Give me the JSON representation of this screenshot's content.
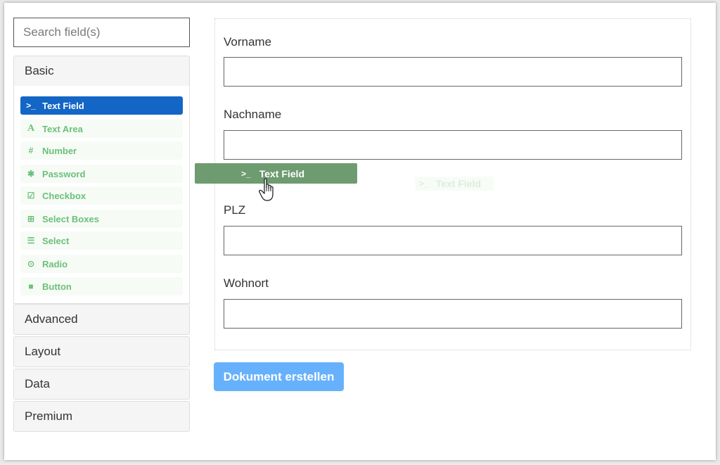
{
  "search": {
    "placeholder": "Search field(s)"
  },
  "groups": {
    "basic": "Basic",
    "advanced": "Advanced",
    "layout": "Layout",
    "data": "Data",
    "premium": "Premium"
  },
  "components": [
    {
      "icon": "terminal-icon",
      "glyph": ">_",
      "label": "Text Field"
    },
    {
      "icon": "font-icon",
      "glyph": "A",
      "label": "Text Area"
    },
    {
      "icon": "hash-icon",
      "glyph": "#",
      "label": "Number"
    },
    {
      "icon": "asterisk-icon",
      "glyph": "✱",
      "label": "Password"
    },
    {
      "icon": "check-square-icon",
      "glyph": "☑",
      "label": "Checkbox"
    },
    {
      "icon": "plus-square-icon",
      "glyph": "⊞",
      "label": "Select Boxes"
    },
    {
      "icon": "list-icon",
      "glyph": "☰",
      "label": "Select"
    },
    {
      "icon": "dot-circle-icon",
      "glyph": "⊙",
      "label": "Radio"
    },
    {
      "icon": "stop-icon",
      "glyph": "■",
      "label": "Button"
    }
  ],
  "form": {
    "fields": [
      "Vorname",
      "Nachname",
      "PLZ",
      "Wohnort"
    ],
    "submit_label": "Dokument erstellen"
  },
  "drag": {
    "glyph": ">_",
    "label": "Text Field"
  },
  "drop": {
    "glyph": ">_",
    "label": "Text Field"
  },
  "colors": {
    "active": "#1366c6",
    "component_text": "#6cc07a",
    "drag_ghost": "#6e9c70",
    "submit": "#67b1fc"
  }
}
